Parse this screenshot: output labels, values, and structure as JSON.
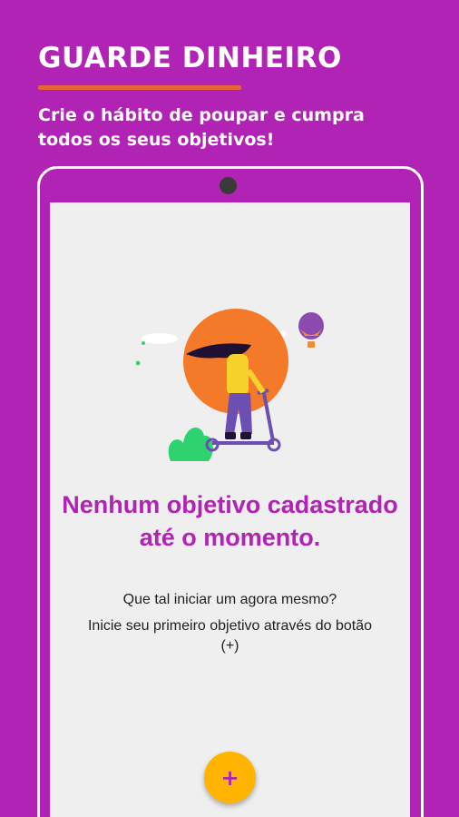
{
  "promo": {
    "title": "GUARDE DINHEIRO",
    "subtitle": "Crie o hábito de poupar e cumpra todos os seus objetivos!"
  },
  "empty_state": {
    "title": "Nenhum objetivo cadastrado até o momento.",
    "question": "Que tal iniciar um agora mesmo?",
    "hint": "Inicie seu primeiro objetivo através do botão (+)",
    "illustration": "girl-on-scooter-illustration"
  },
  "fab": {
    "label": "+",
    "icon": "plus-icon"
  },
  "colors": {
    "brand_purple": "#b023b4",
    "accent_orange": "#e8643a",
    "fab_yellow": "#ffb400",
    "screen_bg": "#efefef"
  }
}
